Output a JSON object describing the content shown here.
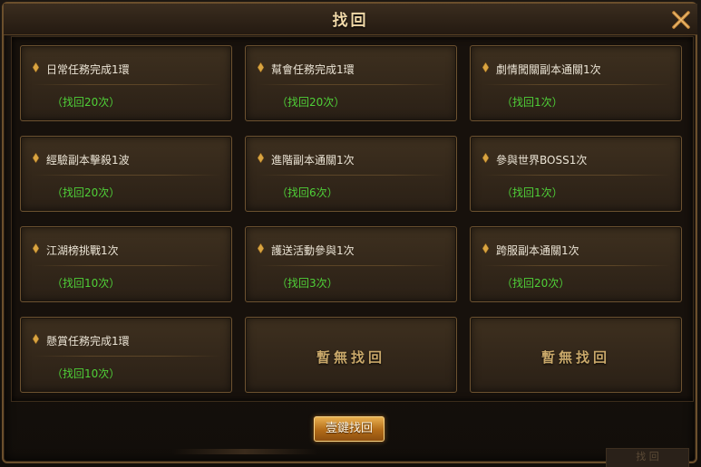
{
  "window": {
    "title": "找回",
    "one_click_label": "壹鍵找回",
    "footer_tab_label": "找 回"
  },
  "slots": [
    {
      "title": "日常任務完成1環",
      "count": "（找回20次）",
      "empty": false
    },
    {
      "title": "幫會任務完成1環",
      "count": "（找回20次）",
      "empty": false
    },
    {
      "title": "劇情闖關副本通關1次",
      "count": "（找回1次）",
      "empty": false
    },
    {
      "title": "經驗副本擊殺1波",
      "count": "（找回20次）",
      "empty": false
    },
    {
      "title": "進階副本通關1次",
      "count": "（找回6次）",
      "empty": false
    },
    {
      "title": "參與世界BOSS1次",
      "count": "（找回1次）",
      "empty": false
    },
    {
      "title": "江湖榜挑戰1次",
      "count": "（找回10次）",
      "empty": false
    },
    {
      "title": "護送活動參與1次",
      "count": "（找回3次）",
      "empty": false
    },
    {
      "title": "跨服副本通關1次",
      "count": "（找回20次）",
      "empty": false
    },
    {
      "title": "懸賞任務完成1環",
      "count": "（找回10次）",
      "empty": false
    },
    {
      "empty": true,
      "empty_label": "暫無找回"
    },
    {
      "empty": true,
      "empty_label": "暫無找回"
    }
  ],
  "colors": {
    "accent_gold": "#c9a86a",
    "count_green": "#4fcf38",
    "button_orange": "#b26b18"
  },
  "icons": {
    "close": "close-x-icon",
    "bullet": "gold-diamond-bullet-icon"
  }
}
